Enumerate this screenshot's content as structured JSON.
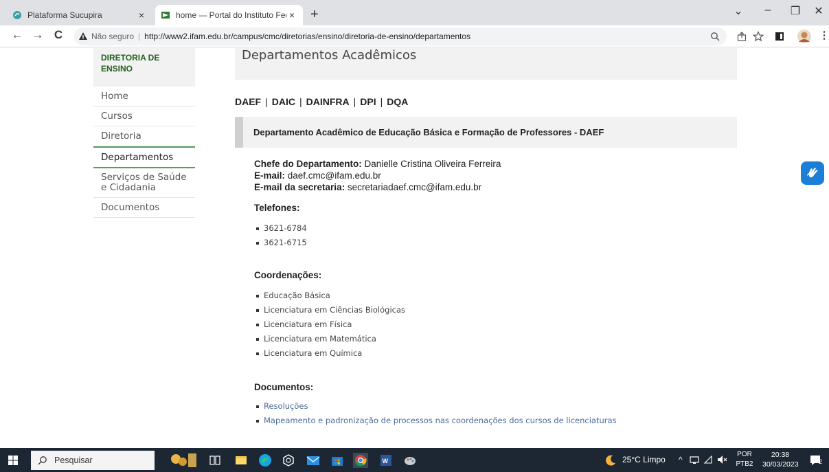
{
  "browser": {
    "tabs": [
      {
        "title": "Plataforma Sucupira",
        "close": "×"
      },
      {
        "title": "home — Portal do Instituto Fede",
        "close": "×"
      }
    ],
    "new_tab": "+",
    "window_controls": {
      "minimize": "–",
      "restore": "❐",
      "close": "✕",
      "dropdown": "⌄"
    },
    "nav": {
      "back": "←",
      "forward": "→",
      "reload": "C"
    },
    "security_label": "Não seguro",
    "separator": "|",
    "url": "http://www2.ifam.edu.br/campus/cmc/diretorias/ensino/diretoria-de-ensino/departamentos",
    "toolbar_icons": [
      "zoom-icon",
      "share-icon",
      "star-icon",
      "sidepanel-icon",
      "profile-icon",
      "menu-icon"
    ]
  },
  "sidebar": {
    "heading_line1": "DIRETORIA DE",
    "heading_line2": "ENSINO",
    "items": [
      {
        "label": "Home"
      },
      {
        "label": "Cursos"
      },
      {
        "label": "Diretoria"
      },
      {
        "label": "Departamentos",
        "active": true
      },
      {
        "label": "Serviços de Saúde e Cidadania"
      },
      {
        "label": "Documentos"
      }
    ]
  },
  "main": {
    "title": "Departamentos Acadêmicos",
    "dept_links": [
      "DAEF",
      "DAIC",
      "DAINFRA",
      "DPI",
      "DQA"
    ],
    "dept_separator": "|",
    "dept_header": "Departamento Acadêmico de Educação Básica e Formação de Professores - DAEF",
    "chefe_label": "Chefe do Departamento:",
    "chefe_value": "Danielle Cristina Oliveira Ferreira",
    "email_label": "E-mail:",
    "email_value": "daef.cmc@ifam.edu.br",
    "email_sec_label": "E-mail da secretaria:",
    "email_sec_value": "secretariadaef.cmc@ifam.edu.br",
    "telefones_title": "Telefones:",
    "telefones": [
      "3621-6784",
      "3621-6715"
    ],
    "coordenacoes_title": "Coordenações:",
    "coordenacoes": [
      "Educação Básica",
      "Licenciatura em Ciências Biológicas",
      "Licenciatura em Física",
      "Licenciatura em Matemática",
      "Licenciatura em Química"
    ],
    "documentos_title": "Documentos:",
    "documentos": [
      "Resoluções",
      "Mapeamento e padronização de processos nas coordenações dos cursos de licenciaturas"
    ]
  },
  "taskbar": {
    "search_placeholder": "Pesquisar",
    "weather": "25°C  Limpo",
    "lang_line1": "POR",
    "lang_line2": "PTB2",
    "time": "20:38",
    "date": "30/03/2023",
    "notifications": "2"
  },
  "colors": {
    "sidebar_heading": "#23621f",
    "active_border": "#5a9a5a",
    "link": "#4a6a9a",
    "accessibility_button": "#1c7ed6",
    "taskbar": "#1d2733"
  }
}
